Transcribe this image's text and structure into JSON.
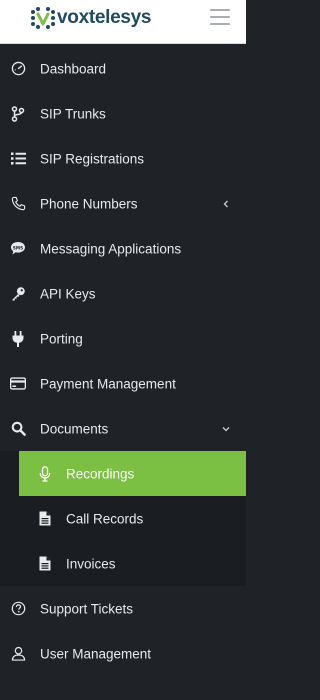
{
  "brand": {
    "name": "voxtelesys",
    "color": "#1f4a63",
    "mark_color": "#7cc043"
  },
  "header": {
    "menu_icon": "hamburger-icon"
  },
  "nav": {
    "items": [
      {
        "label": "Dashboard",
        "icon": "speedometer-icon"
      },
      {
        "label": "SIP Trunks",
        "icon": "branch-icon"
      },
      {
        "label": "SIP Registrations",
        "icon": "list-icon"
      },
      {
        "label": "Phone Numbers",
        "icon": "phone-icon",
        "expandable": true,
        "expanded": false
      },
      {
        "label": "Messaging Applications",
        "icon": "sms-bubble-icon"
      },
      {
        "label": "API Keys",
        "icon": "key-icon"
      },
      {
        "label": "Porting",
        "icon": "plug-icon"
      },
      {
        "label": "Payment Management",
        "icon": "credit-card-icon"
      },
      {
        "label": "Documents",
        "icon": "search-icon",
        "expandable": true,
        "expanded": true
      },
      {
        "label": "Support Tickets",
        "icon": "question-circle-icon"
      },
      {
        "label": "User Management",
        "icon": "user-icon"
      }
    ],
    "documents_children": [
      {
        "label": "Recordings",
        "icon": "microphone-icon",
        "selected": true
      },
      {
        "label": "Call Records",
        "icon": "file-text-icon",
        "selected": false
      },
      {
        "label": "Invoices",
        "icon": "file-text-icon",
        "selected": false
      }
    ]
  },
  "colors": {
    "sidebar_bg": "#1f2327",
    "submenu_bg": "#1a1d21",
    "selected_bg": "#7cc043",
    "text": "#e8eaec"
  }
}
